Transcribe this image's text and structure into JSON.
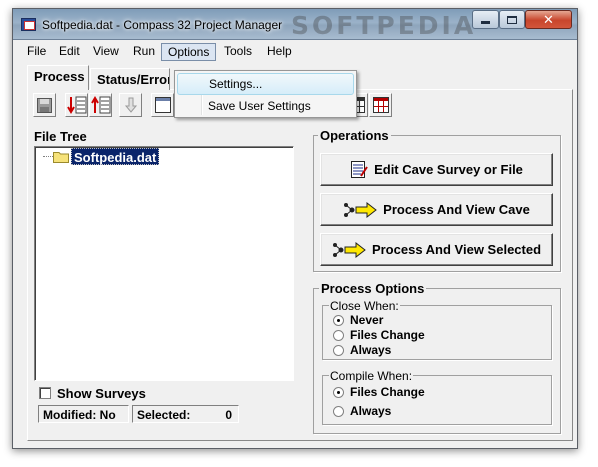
{
  "window": {
    "title": "Softpedia.dat - Compass 32 Project Manager",
    "watermark": "SOFTPEDIA",
    "icons": {
      "app": "compass-app-icon",
      "minimize": "minimize-icon",
      "maximize": "maximize-icon",
      "close": "close-icon"
    }
  },
  "menu": {
    "file": "File",
    "edit": "Edit",
    "view": "View",
    "run": "Run",
    "options": "Options",
    "tools": "Tools",
    "help": "Help"
  },
  "options_menu": {
    "items": [
      "Settings...",
      "Save User Settings"
    ],
    "highlighted_index": 0
  },
  "tabs": {
    "process": "Process",
    "status": "Status/Errors"
  },
  "toolbar": {
    "icons": [
      "save-icon",
      "sort-down-icon",
      "sort-up-icon",
      "move-down-icon",
      "table-icon",
      "table-red-icon"
    ]
  },
  "file_tree": {
    "label": "File Tree",
    "root_item": "Softpedia.dat",
    "show_surveys_label": "Show Surveys",
    "show_surveys_checked": false,
    "modified": "Modified: No",
    "selected_label": "Selected:",
    "selected_count": "0"
  },
  "operations": {
    "label": "Operations",
    "edit_button": "Edit Cave Survey or File",
    "process_view_cave_button": "Process And View Cave",
    "process_view_selected_button": "Process And View Selected"
  },
  "process_options": {
    "label": "Process Options",
    "close_when": {
      "label": "Close When:",
      "options": [
        "Never",
        "Files Change",
        "Always"
      ],
      "selected": "Never"
    },
    "compile_when": {
      "label": "Compile When:",
      "options": [
        "Files Change",
        "Always"
      ],
      "selected": "Files Change"
    }
  },
  "colors": {
    "selection": "#0a246a",
    "folder": "#f6e27a",
    "arrow": "#ffe800"
  }
}
